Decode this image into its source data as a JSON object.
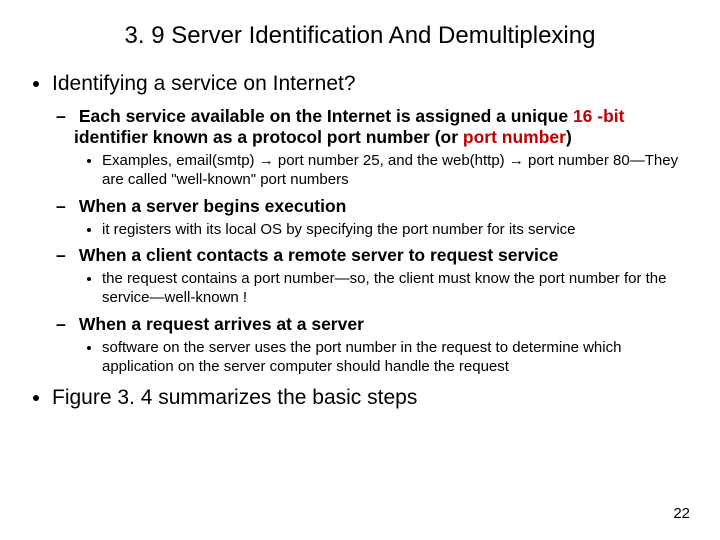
{
  "title": "3. 9  Server Identification And Demultiplexing",
  "b1": "Identifying a service on Internet?",
  "b1_1_pre": "Each service available on the Internet is assigned a unique ",
  "b1_1_red": "16 -bit",
  "b1_1_mid": " identifier known as a protocol port number (or ",
  "b1_1_red2": "port number",
  "b1_1_post": ")",
  "b1_1_ex": "Examples, email(smtp) → port number 25, and the web(http) → port number 80—They are called \"well-known\" port numbers",
  "b1_2": "When a server begins execution",
  "b1_2_ex": "it registers with its local OS by specifying the port number for its service",
  "b1_3": "When a client contacts a remote server to request service",
  "b1_3_ex": "the request contains a port number—so, the client must know the port number for the service—well-known !",
  "b1_4": "When a request arrives at a server",
  "b1_4_ex": "software on the server uses the port number in the request to determine which application on the server computer should handle the request",
  "b2": "Figure 3. 4 summarizes the basic steps",
  "page": "22"
}
